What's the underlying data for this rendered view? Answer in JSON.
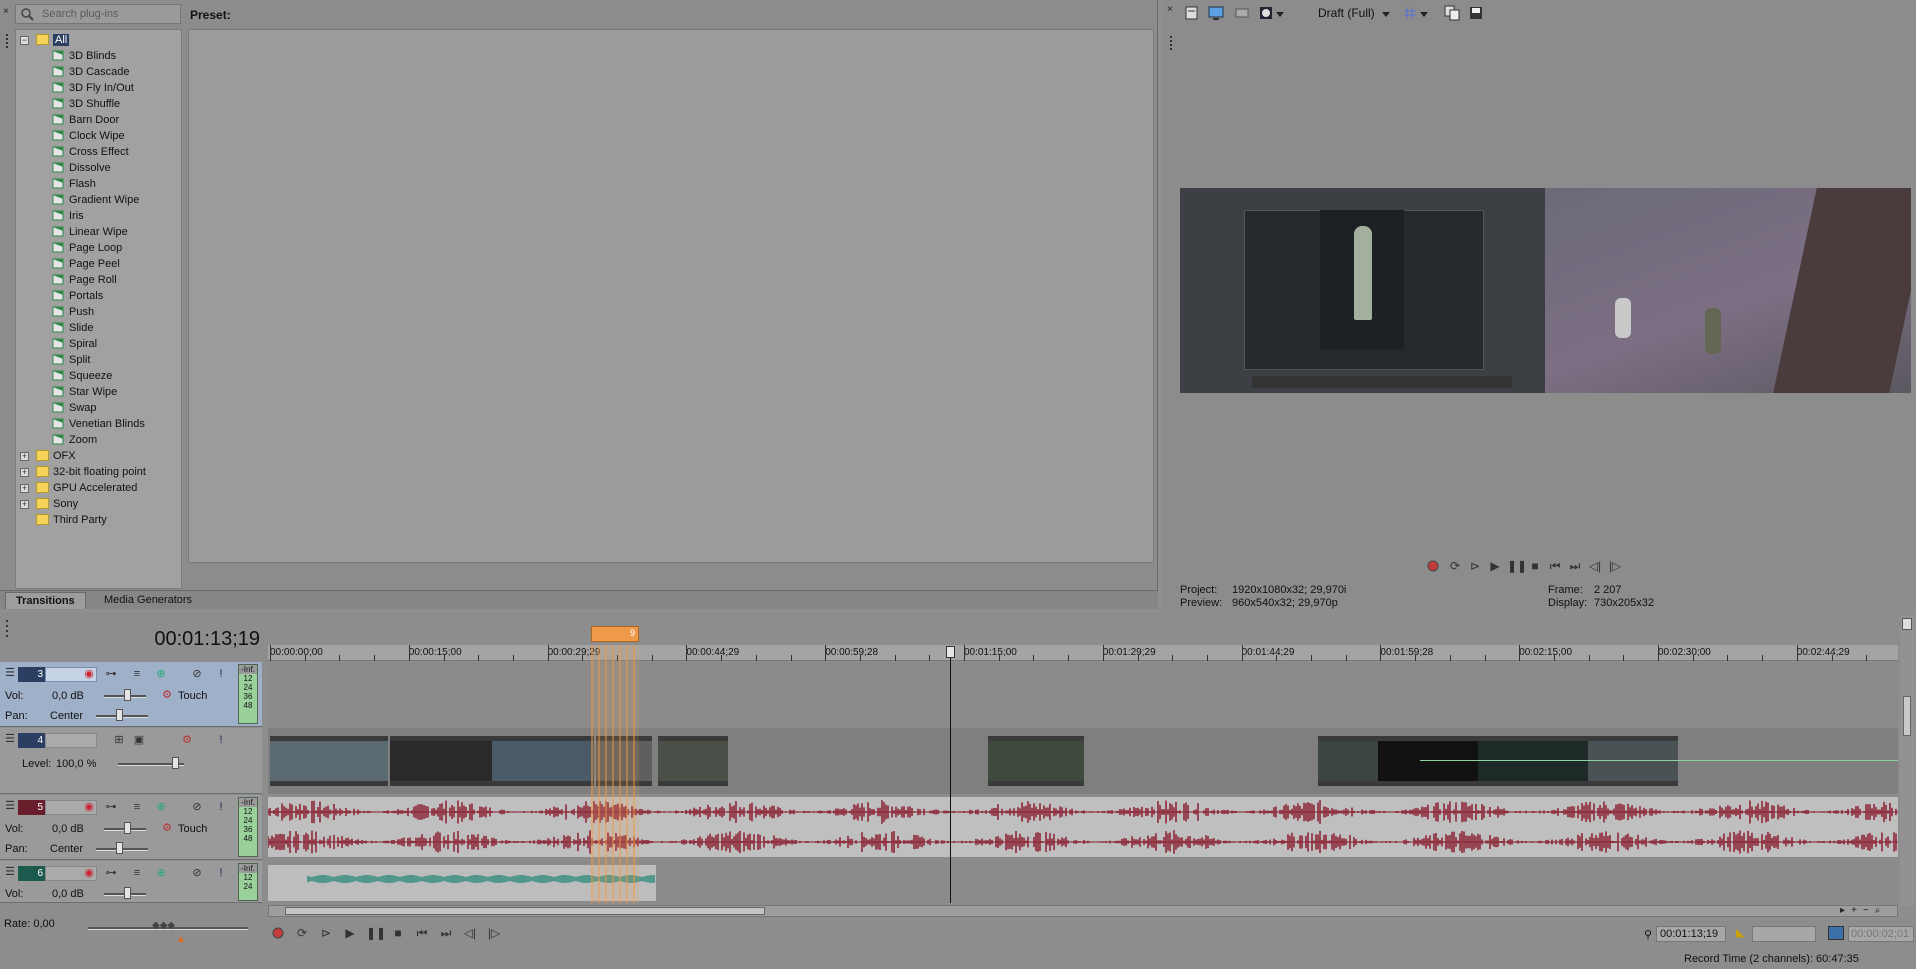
{
  "plugins": {
    "search_placeholder": "Search plug-ins",
    "root": "All",
    "items": [
      "3D Blinds",
      "3D Cascade",
      "3D Fly In/Out",
      "3D Shuffle",
      "Barn Door",
      "Clock Wipe",
      "Cross Effect",
      "Dissolve",
      "Flash",
      "Gradient Wipe",
      "Iris",
      "Linear Wipe",
      "Page Loop",
      "Page Peel",
      "Page Roll",
      "Portals",
      "Push",
      "Slide",
      "Spiral",
      "Split",
      "Squeeze",
      "Star Wipe",
      "Swap",
      "Venetian Blinds",
      "Zoom"
    ],
    "folders": [
      "OFX",
      "32-bit floating point",
      "GPU Accelerated",
      "Sony",
      "Third Party"
    ]
  },
  "preset_label": "Preset:",
  "tabs": {
    "transitions": "Transitions",
    "media_generators": "Media Generators"
  },
  "preview": {
    "quality": "Draft (Full)",
    "project_label": "Project:",
    "project_value": "1920x1080x32; 29,970i",
    "preview_label": "Preview:",
    "preview_value": "960x540x32; 29,970p",
    "frame_label": "Frame:",
    "frame_value": "2 207",
    "display_label": "Display:",
    "display_value": "730x205x32"
  },
  "timeline": {
    "current_time": "00:01:13;19",
    "marker": "9",
    "ruler": [
      "00:00:00;00",
      "00:00:15;00",
      "00:00:29;29",
      "00:00:44;29",
      "00:00:59;28",
      "00:01:15;00",
      "00:01:29;29",
      "00:01:44;29",
      "00:01:59;28",
      "00:02:15;00",
      "00:02:30;00",
      "00:02:44;29"
    ],
    "tracks": [
      {
        "num": "3",
        "vol_label": "Vol:",
        "vol": "0,0 dB",
        "pan_label": "Pan:",
        "pan": "Center",
        "mode": "Touch"
      },
      {
        "num": "4",
        "level_label": "Level:",
        "level": "100,0 %"
      },
      {
        "num": "5",
        "vol_label": "Vol:",
        "vol": "0,0 dB",
        "pan_label": "Pan:",
        "pan": "Center",
        "mode": "Touch"
      },
      {
        "num": "6",
        "vol_label": "Vol:",
        "vol": "0,0 dB"
      }
    ],
    "meter_labels": [
      "-Inf.",
      "12",
      "24",
      "36",
      "48"
    ],
    "rate_label": "Rate: 0,00",
    "cursor_time": "00:01:13;19",
    "end_time": "00:00:02;01",
    "record_time": "Record Time (2 channels): 60:47:35"
  },
  "colors": {
    "wave": "#8a1e30",
    "green_wave": "#2f8a7a",
    "selection": "#e8913a",
    "track_sel": "#9fb0c9"
  }
}
